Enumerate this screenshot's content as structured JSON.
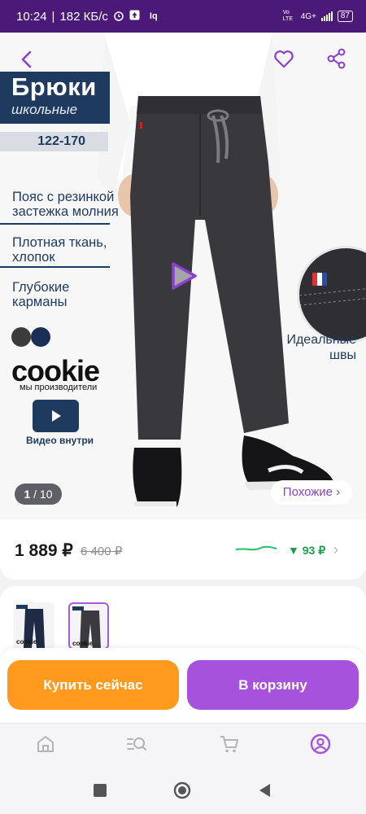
{
  "status_bar": {
    "time": "10:24",
    "speed": "182 КБ/с",
    "app_label": "Iq",
    "network": "4G+",
    "vo_label": "Vo LTE",
    "battery": "87"
  },
  "product": {
    "title": "Брюки",
    "subtitle": "школьные",
    "sizes": "122-170",
    "features": [
      "Пояс с резинкой застежка молния",
      "Плотная ткань, хлопок",
      "Глубокие карманы"
    ],
    "brand": "cookie",
    "brand_tagline": "мы производители",
    "video_label": "Видео внутри",
    "seams_label": "Идеальные швы",
    "image_counter_current": "1",
    "image_counter_total": "/ 10",
    "similar_label": "Похожие ›"
  },
  "price": {
    "current": "1 889 ₽",
    "old": "6 400 ₽",
    "drop": "▼ 93 ₽",
    "chevron": "›"
  },
  "thumbnails": {
    "brand": "cookie"
  },
  "actions": {
    "buy_now": "Купить сейчас",
    "add_to_cart": "В корзину"
  },
  "colors": {
    "accent": "#a652dc",
    "buy": "#ff9a1e",
    "status_bar": "#4b1a78",
    "navy": "#1e3a5f",
    "price_drop": "#15a24b"
  }
}
